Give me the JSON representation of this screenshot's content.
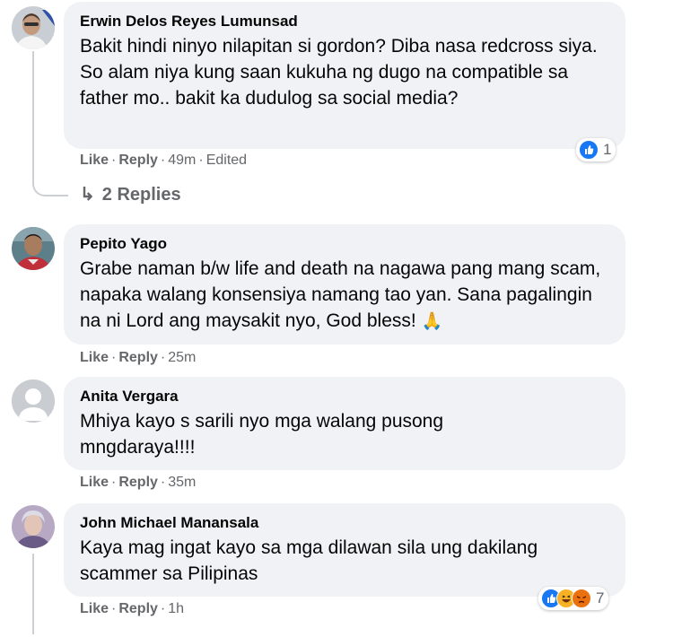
{
  "comments": [
    {
      "author": "Erwin Delos Reyes Lumunsad",
      "text": "Bakit hindi ninyo nilapitan si gordon? Diba nasa redcross siya. So alam niya kung saan kukuha ng dugo na compatible sa father mo.. bakit ka dudulog sa social media?",
      "like": "Like",
      "reply": "Reply",
      "time": "49m",
      "edited": "Edited",
      "reaction_count": "1",
      "reactions": [
        "like-icon"
      ]
    },
    {
      "author": "Pepito Yago",
      "text": "Grabe naman b/w life and death na nagawa pang mang scam, napaka walang konsensiya namang tao yan. Sana pagalingin na ni Lord ang maysakit nyo, God bless!",
      "like": "Like",
      "reply": "Reply",
      "time": "25m",
      "emoji": "🙏"
    },
    {
      "author": "Anita Vergara",
      "text": "Mhiya kayo s sarili nyo mga walang pusong mngdaraya!!!!",
      "like": "Like",
      "reply": "Reply",
      "time": "35m"
    },
    {
      "author": "John Michael Manansala",
      "text": "Kaya mag ingat kayo sa mga dilawan sila ung dakilang scammer sa Pilipinas",
      "like": "Like",
      "reply": "Reply",
      "time": "1h",
      "reaction_count": "7",
      "reactions": [
        "like-icon",
        "haha-icon",
        "angry-icon"
      ]
    }
  ],
  "replies_link": {
    "arrow": "↳",
    "label": "2 Replies"
  },
  "separator": "·",
  "colors": {
    "bubble": "#f0f2f5",
    "meta_text": "#65676b",
    "like_blue": "#1877f2",
    "haha_yellow": "#f7b125",
    "angry_orange": "#e9710f"
  }
}
